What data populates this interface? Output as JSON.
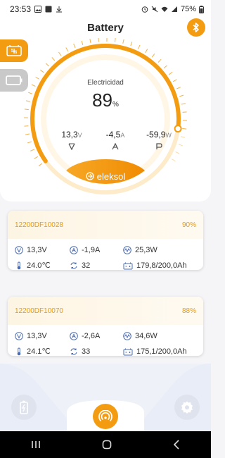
{
  "status_bar": {
    "time": "23:53",
    "battery": "75%"
  },
  "header": {
    "title": "Battery"
  },
  "gauge": {
    "label": "Electricidad",
    "value": "89",
    "unit": "%",
    "level_fraction": 0.89,
    "voltage": "13,3",
    "voltage_unit": "V",
    "current": "-4,5",
    "current_unit": "A",
    "power": "-59,9",
    "power_unit": "W"
  },
  "brand": "eleksol",
  "packs": [
    {
      "id": "12200DF10028",
      "percent": "90%",
      "voltage": "13,3V",
      "current": "-1,9A",
      "power": "25,3W",
      "temperature": "24.0℃",
      "cycles": "32",
      "capacity": "179,8/200,0Ah"
    },
    {
      "id": "12200DF10070",
      "percent": "88%",
      "voltage": "13,3V",
      "current": "-2,6A",
      "power": "34,6W",
      "temperature": "24.1℃",
      "cycles": "33",
      "capacity": "175,1/200,0Ah"
    }
  ],
  "icons": {
    "bluetooth": "bluetooth-icon",
    "battery_tab": "battery-pack-icon",
    "battery_empty": "battery-outline-icon",
    "nav_left": "battery-charge-icon",
    "nav_center": "signal-icon",
    "nav_right": "gear-icon"
  },
  "colors": {
    "accent": "#f39c12",
    "accent_light": "#fde7c1",
    "tab_inactive": "#c9c9c9"
  }
}
